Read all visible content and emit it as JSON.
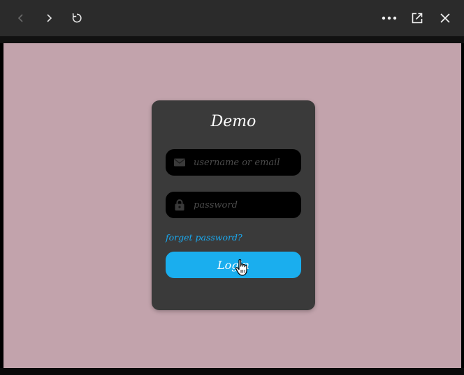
{
  "toolbar": {
    "back_icon": "chevron-left-icon",
    "forward_icon": "chevron-right-icon",
    "reload_icon": "reload-icon",
    "more_icon": "more-horizontal-icon",
    "popout_icon": "external-open-icon",
    "close_icon": "close-icon"
  },
  "colors": {
    "page_background": "#c2a3ac",
    "card_background": "#3a3a3a",
    "field_background": "#000000",
    "accent": "#1aaeee",
    "link": "#1aa8ee"
  },
  "login": {
    "title": "Demo",
    "username": {
      "placeholder": "username or email",
      "value": "",
      "icon": "envelope-icon"
    },
    "password": {
      "placeholder": "password",
      "value": "",
      "icon": "lock-icon"
    },
    "forgot_label": "forget password?",
    "submit_label": "Login"
  }
}
